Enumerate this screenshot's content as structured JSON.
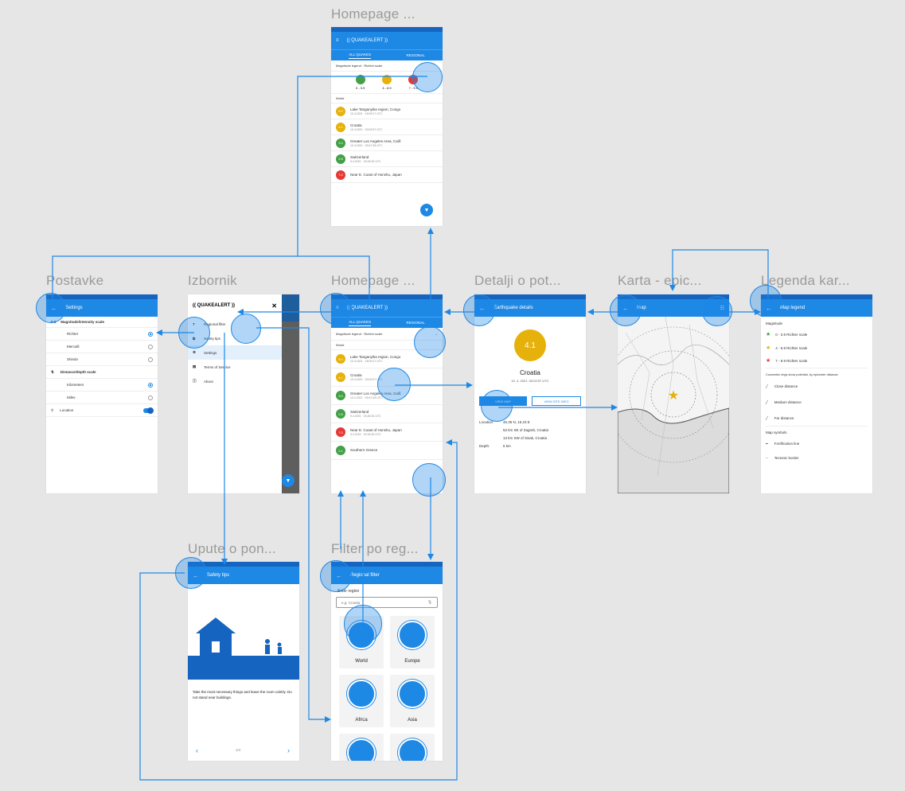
{
  "frames": {
    "homepage_top": "Homepage ...",
    "postavke": "Postavke",
    "izbornik": "Izbornik",
    "homepage_mid": "Homepage ...",
    "detalji": "Detalji o pot...",
    "karta": "Karta - epic...",
    "legenda": "Legenda kar...",
    "upute": "Upute o pon...",
    "filter": "Filter po reg..."
  },
  "app": {
    "logo": "(( QUAKEALERT ))",
    "tab_all": "ALL QUAKES",
    "tab_regional": "REGIONAL",
    "magnitude_label": "Magnitude legend · Richter scale",
    "region_world": "World"
  },
  "home_top": {
    "legend": [
      "0 - 3.9",
      "4 - 6.9",
      "7 - 9.9"
    ],
    "quakes": [
      {
        "mag": "5.0",
        "place": "Lake Tanganyika region, Congo",
        "time": "10.4.2021 · 18:09:17 UTC",
        "color": "#e6b10a"
      },
      {
        "mag": "4.1",
        "place": "Croatia",
        "time": "10.4.2021 · 00:02:57 UTC",
        "color": "#e6b10a"
      },
      {
        "mag": "3.0",
        "place": "Greater Los Angeles Area, Calif.",
        "time": "10.4.2021 · 09:47:28 UTC",
        "color": "#43a047"
      },
      {
        "mag": "2.8",
        "place": "Switzerland",
        "time": "9.4.2021 · 23:49:32 UTC",
        "color": "#43a047"
      },
      {
        "mag": "7.0",
        "place": "Near E. Coast of Honshu, Japan",
        "time": "",
        "color": "#e53935"
      }
    ]
  },
  "home_mid": {
    "quakes": [
      {
        "mag": "5.0",
        "place": "Lake Tanganyika region, Congo",
        "time": "10.4.2021 · 18:09:17 UTC",
        "color": "#e6b10a"
      },
      {
        "mag": "4.1",
        "place": "Croatia",
        "time": "10.4.2021 · 00:02:57 UTC",
        "color": "#e6b10a"
      },
      {
        "mag": "3.0",
        "place": "Greater Los Angeles Area, Calif.",
        "time": "10.4.2021 · 09:47:28 UTC",
        "color": "#43a047"
      },
      {
        "mag": "2.8",
        "place": "Switzerland",
        "time": "9.4.2021 · 23:49:32 UTC",
        "color": "#43a047"
      },
      {
        "mag": "7.0",
        "place": "Near E. Coast of Honshu, Japan",
        "time": "9.4.2021 · 22:24:40 UTC",
        "color": "#e53935"
      },
      {
        "mag": "2.1",
        "place": "Southern Greece",
        "time": "",
        "color": "#43a047"
      }
    ]
  },
  "settings": {
    "title": "Settings",
    "magnitude_header": "Magnitude/intensity scale",
    "options_mag": [
      "Richter",
      "Mercalli",
      "Shindo"
    ],
    "distance_header": "Distance/depth scale",
    "options_dist": [
      "Kilometers",
      "Miles"
    ],
    "location": "Location"
  },
  "menu": {
    "items": [
      "Regional filter",
      "Safety tips",
      "Settings",
      "Terms of Service",
      "About"
    ]
  },
  "details": {
    "title": "Earthquake details",
    "mag": "4.1",
    "place": "Croatia",
    "time": "10. 4. 2021.   00:02:57 UTC",
    "btn_map": "VIEW MAP",
    "btn_more": "VIEW SITE INFO",
    "location_label": "Location:",
    "location_coords": "45.35 N, 16.23 E",
    "loc_line2": "52 km SE of Zagreb, Croatia",
    "loc_line3": "13 km SW of Sisak, Croatia",
    "depth_label": "Depth:",
    "depth": "5 km"
  },
  "map": {
    "title": "Map",
    "legend_btn": "Legend"
  },
  "legend": {
    "title": "Map legend",
    "magnitude": "Magnitude",
    "mag_items": [
      "0 - 3.9 Richter scale",
      "4 - 6.9 Richter scale",
      "7 - 9.9 Richter scale"
    ],
    "circles_note": "Concentric rings show potential, by epicenter distance",
    "rings": [
      "Close distance",
      "Medium distance",
      "Far distance"
    ],
    "symbols": "Map symbols",
    "sym_items": [
      "Fortification line",
      "Tectonic border"
    ]
  },
  "safety": {
    "title": "Safety tips",
    "text": "Take the most necessary things and leave the room calmly. Do not stand near buildings.",
    "pager": "1/4"
  },
  "filter": {
    "title": "Regional filter",
    "choose": "Enter region",
    "placeholder": "e.g. Croatia",
    "regions": [
      "World",
      "Europe",
      "Africa",
      "Asia"
    ]
  },
  "colors": {
    "primary": "#1e88e5",
    "dark": "#1565c0",
    "yellow": "#e6b10a",
    "green": "#43a047",
    "red": "#e53935"
  }
}
